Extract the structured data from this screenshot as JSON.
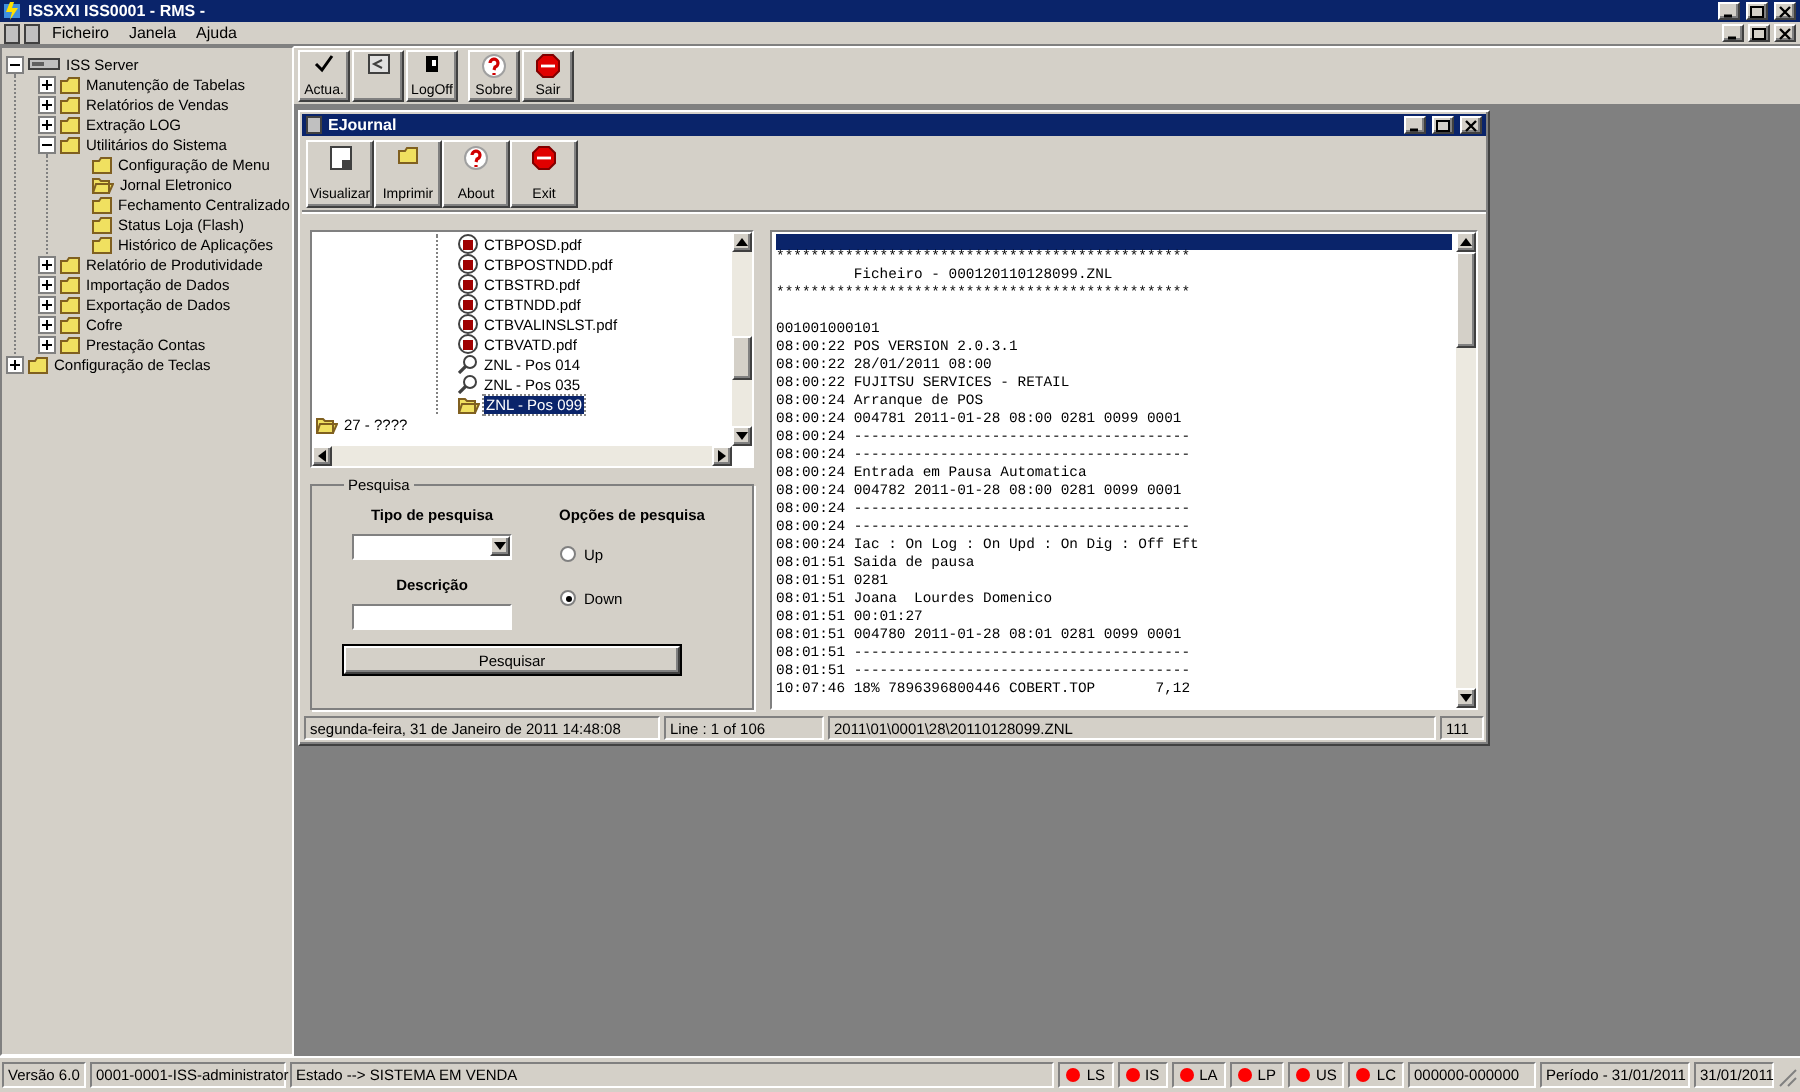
{
  "app_window": {
    "title": "ISSXXI ISS0001 - RMS -"
  },
  "menu": [
    "Ficheiro",
    "Janela",
    "Ajuda"
  ],
  "nav_tree": [
    {
      "label": "ISS Server",
      "kind": "server",
      "expanded": true,
      "children": [
        {
          "label": "Manutenção de Tabelas",
          "kind": "folder",
          "expanded": false
        },
        {
          "label": "Relatórios de Vendas",
          "kind": "folder",
          "expanded": false
        },
        {
          "label": "Extração LOG",
          "kind": "folder",
          "expanded": false
        },
        {
          "label": "Utilitários do Sistema",
          "kind": "folder",
          "expanded": true,
          "children": [
            {
              "label": "Configuração de Menu",
              "kind": "folder"
            },
            {
              "label": "Jornal Eletronico",
              "kind": "open-folder"
            },
            {
              "label": "Fechamento Centralizado",
              "kind": "folder"
            },
            {
              "label": "Status Loja (Flash)",
              "kind": "folder"
            },
            {
              "label": "Histórico de Aplicações",
              "kind": "folder"
            }
          ]
        },
        {
          "label": "Relatório de Produtividade",
          "kind": "folder",
          "expanded": false
        },
        {
          "label": "Importação de Dados",
          "kind": "folder",
          "expanded": false
        },
        {
          "label": "Exportação de Dados",
          "kind": "folder",
          "expanded": false
        },
        {
          "label": "Cofre",
          "kind": "folder",
          "expanded": false
        },
        {
          "label": "Prestação Contas",
          "kind": "folder",
          "expanded": false
        }
      ]
    },
    {
      "label": "Configuração de Teclas",
      "kind": "folder",
      "expanded": false
    }
  ],
  "toolbar_groups": [
    [
      {
        "label": "Actua.",
        "kind": "check"
      },
      {
        "kind": "window"
      },
      {
        "label": "LogOff",
        "kind": "logoff"
      }
    ],
    [
      {
        "label": "Sobre",
        "kind": "help"
      },
      {
        "label": "Sair",
        "kind": "stop"
      }
    ]
  ],
  "ejournal": {
    "title": "EJournal",
    "toolbar": [
      {
        "label": "Visualizar",
        "kind": "page"
      },
      {
        "label": "Imprimir",
        "kind": "folder"
      },
      {
        "label": "About",
        "kind": "help"
      },
      {
        "label": "Exit",
        "kind": "stop"
      }
    ],
    "file_tree": [
      {
        "children": [
          {
            "label": "CTBPOSD.pdf",
            "kind": "pdf",
            "selected": false
          },
          {
            "label": "CTBPOSTNDD.pdf",
            "kind": "pdf",
            "selected": false
          },
          {
            "label": "CTBSTRD.pdf",
            "kind": "pdf",
            "selected": false
          },
          {
            "label": "CTBTNDD.pdf",
            "kind": "pdf",
            "selected": false
          },
          {
            "label": "CTBVALINSLST.pdf",
            "kind": "pdf",
            "selected": false
          },
          {
            "label": "CTBVATD.pdf",
            "kind": "pdf",
            "selected": false
          },
          {
            "label": "ZNL - Pos 014",
            "kind": "magnifier",
            "selected": false
          },
          {
            "label": "ZNL - Pos 035",
            "kind": "magnifier",
            "selected": false
          },
          {
            "label": "ZNL - Pos 099",
            "kind": "open-folder",
            "selected": true
          }
        ]
      },
      {
        "label": "27 - ????",
        "kind": "open-folder",
        "selected": false
      }
    ],
    "search": {
      "title": "Pesquisa",
      "type_label": "Tipo de pesquisa",
      "options_label": "Opções de pesquisa",
      "description_label": "Descrição",
      "directions": [
        {
          "label": "Up",
          "selected": false
        },
        {
          "label": "Down",
          "selected": true
        }
      ],
      "button": "Pesquisar"
    },
    "log": {
      "first_line_selected": true,
      "lines": [
        {
          "text": "************************************************"
        },
        {
          "text": "         Ficheiro - 000120110128099.ZNL"
        },
        {
          "text": "************************************************"
        },
        {
          "text": "001001000101",
          "gap_before": true
        },
        {
          "text": "08:00:22 POS VERSION 2.0.3.1"
        },
        {
          "text": "08:00:22 28/01/2011 08:00"
        },
        {
          "text": "08:00:22 FUJITSU SERVICES - RETAIL"
        },
        {
          "text": "08:00:24 Arranque de POS"
        },
        {
          "text": "08:00:24 004781 2011-01-28 08:00 0281 0099 0001"
        },
        {
          "text": "08:00:24 ---------------------------------------"
        },
        {
          "text": "08:00:24 ---------------------------------------"
        },
        {
          "text": "08:00:24 Entrada em Pausa Automatica"
        },
        {
          "text": "08:00:24 004782 2011-01-28 08:00 0281 0099 0001"
        },
        {
          "text": "08:00:24 ---------------------------------------"
        },
        {
          "text": "08:00:24 ---------------------------------------"
        },
        {
          "text": "08:00:24 Iac : On Log : On Upd : On Dig : Off Eft"
        },
        {
          "text": "08:01:51 Saida de pausa"
        },
        {
          "text": "08:01:51 0281"
        },
        {
          "text": "08:01:51 Joana  Lourdes Domenico"
        },
        {
          "text": "08:01:51 00:01:27"
        },
        {
          "text": "08:01:51 004780 2011-01-28 08:01 0281 0099 0001"
        },
        {
          "text": "08:01:51 ---------------------------------------"
        },
        {
          "text": "08:01:51 ---------------------------------------"
        },
        {
          "text": "10:07:46 18% 7896396800446 COBERT.TOP       7,12"
        }
      ]
    },
    "status": {
      "datetime": "segunda-feira, 31 de Janeiro de 2011   14:48:08",
      "line": "Line : 1 of 106",
      "file": "2011\\01\\0001\\28\\20110128099.ZNL",
      "count": "111"
    }
  },
  "status_bar": {
    "version": "Versão 6.0",
    "user": "0001-0001-ISS-administrator",
    "state": "Estado --> SISTEMA EM VENDA",
    "indicators": [
      {
        "label": "LS",
        "color": "#ff0000"
      },
      {
        "label": "IS",
        "color": "#ff0000"
      },
      {
        "label": "LA",
        "color": "#ff0000"
      },
      {
        "label": "LP",
        "color": "#ff0000"
      },
      {
        "label": "US",
        "color": "#ff0000"
      },
      {
        "label": "LC",
        "color": "#ff0000"
      }
    ],
    "code": "000000-000000",
    "period": "Período - 31/01/2011",
    "date": "31/01/2011"
  }
}
